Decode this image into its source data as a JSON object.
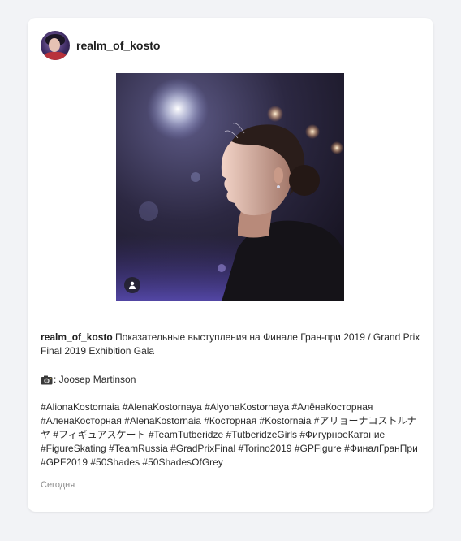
{
  "post": {
    "username": "realm_of_kosto",
    "caption_text": "Показательные выступления на Финале Гран-при 2019 / Grand Prix Final 2019 Exhibition Gala",
    "credit_text": ": Joosep Martinson",
    "hashtags_text": "#AlionaKostornaia #AlenaKostornaya #AlyonaKostornaya #АлёнаКосторная #АленаКосторная #AlenaKostornaia #Косторная #Kostornaia #アリョーナコストルナヤ #フィギュアスケート #TeamTutberidze #TutberidzeGirls #ФигурноеКатание #FigureSkating #TeamRussia #GradPrixFinal #Torino2019 #GPFigure #ФиналГранПри #GPF2019 #50Shades #50ShadesOfGrey",
    "timestamp": "Сегодня"
  },
  "icons": {
    "avatar": "profile-avatar",
    "tagged_people": "person-icon",
    "camera": "camera-emoji-icon"
  },
  "colors": {
    "page_background": "#f2f3f6",
    "card_background": "#ffffff",
    "timestamp": "#8d8d8d"
  }
}
